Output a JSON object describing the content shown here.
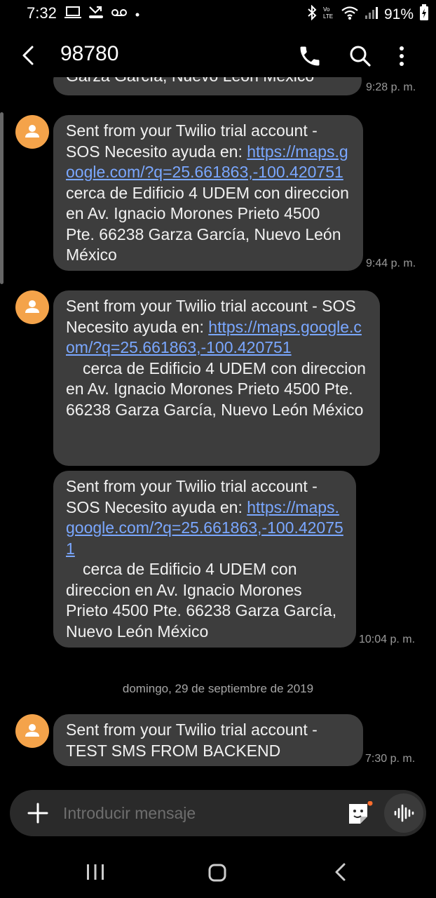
{
  "status_bar": {
    "time": "7:32",
    "battery_percent": "91%",
    "icons": [
      "laptop-icon",
      "missed-call-icon",
      "voicemail-icon",
      "dot-icon",
      "bluetooth-icon",
      "volte-icon",
      "wifi-icon",
      "signal-icon",
      "battery-charging-icon"
    ]
  },
  "header": {
    "title": "98780",
    "icons": [
      "back-arrow-icon",
      "phone-icon",
      "search-icon",
      "more-vert-icon"
    ]
  },
  "messages": [
    {
      "partial_text": "Garza García, Nuevo León México",
      "time": "9:28 p. m."
    },
    {
      "text_before": "Sent from your Twilio trial account - SOS Necesito ayuda en: ",
      "link": "https://maps.google.com/?q=25.661863,-100.420751",
      "text_after": " cerca de Edificio 4 UDEM con direccion en Av. Ignacio Morones Prieto 4500 Pte. 66238 Garza García, Nuevo León México",
      "time": "9:44 p. m."
    },
    {
      "text_before": "Sent from your Twilio trial account - SOS Necesito ayuda en: ",
      "link": "https://maps.google.com/?q=25.661863,-100.420751",
      "text_after": "cerca de Edificio 4 UDEM con direccion en Av. Ignacio Morones Prieto 4500 Pte. 66238 Garza García, Nuevo León México",
      "time": ""
    },
    {
      "text_before": "Sent from your Twilio trial account - SOS Necesito ayuda en: ",
      "link": "https://maps.google.com/?q=25.661863,-100.420751",
      "text_after": "cerca de Edificio 4 UDEM con direccion en Av. Ignacio Morones Prieto 4500 Pte. 66238 Garza García, Nuevo León México",
      "time": "10:04 p. m."
    },
    {
      "text": "Sent from your Twilio trial account - TEST SMS FROM BACKEND",
      "time": "7:30 p. m."
    }
  ],
  "date_separator": "domingo, 29 de septiembre de 2019",
  "composer": {
    "placeholder": "Introducir mensaje",
    "icons": [
      "add-icon",
      "sticker-icon",
      "voice-input-icon"
    ]
  },
  "nav_bar": {
    "icons": [
      "recents-icon",
      "home-icon",
      "nav-back-icon"
    ]
  },
  "colors": {
    "background": "#000000",
    "bubble": "#3d3d3d",
    "link": "#7aa7ff",
    "avatar": "#f4a34a",
    "sticker_badge": "#ff6d2d"
  }
}
